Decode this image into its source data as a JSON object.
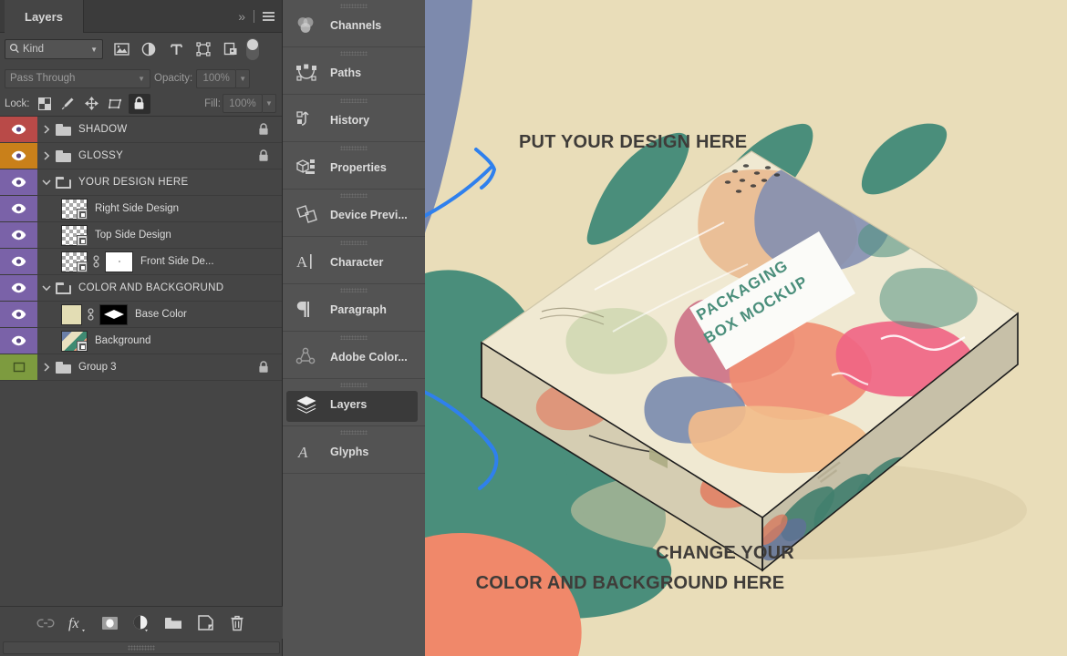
{
  "panel": {
    "tab_title": "Layers",
    "expand_icon": "chevrons-right-icon",
    "menu_icon": "panel-menu-icon",
    "filter": {
      "kind_label": "Kind",
      "search_icon": "search-icon",
      "caret_icon": "chevron-down-icon",
      "icons": [
        {
          "name": "filter-pixel-icon",
          "title": "Pixel layers"
        },
        {
          "name": "filter-adjustment-icon",
          "title": "Adjustment layers"
        },
        {
          "name": "filter-type-icon",
          "title": "Type layers"
        },
        {
          "name": "filter-shape-icon",
          "title": "Shape layers"
        },
        {
          "name": "filter-smartobject-icon",
          "title": "Smart objects"
        }
      ],
      "toggle_name": "filter-enable-toggle"
    },
    "blend": {
      "mode": "Pass Through",
      "opacity_label": "Opacity:",
      "opacity_value": "100%"
    },
    "lock": {
      "label": "Lock:",
      "fill_label": "Fill:",
      "fill_value": "100%",
      "buttons": [
        {
          "name": "lock-transparent-pixels-icon",
          "active": false
        },
        {
          "name": "lock-image-pixels-icon",
          "active": false
        },
        {
          "name": "lock-position-icon",
          "active": false
        },
        {
          "name": "lock-artboard-nesting-icon",
          "active": false
        },
        {
          "name": "lock-all-icon",
          "active": true
        }
      ]
    },
    "layers": [
      {
        "name": "SHADOW",
        "color": "#b94a48",
        "kind": "group",
        "expanded": false,
        "locked": true,
        "visible": true,
        "indent": 0,
        "caps": true
      },
      {
        "name": "GLOSSY",
        "color": "#c9801a",
        "kind": "group",
        "expanded": false,
        "locked": true,
        "visible": true,
        "indent": 0,
        "caps": true
      },
      {
        "name": "YOUR DESIGN HERE",
        "color": "#7a62a8",
        "kind": "group",
        "expanded": true,
        "locked": false,
        "visible": true,
        "indent": 0,
        "caps": true
      },
      {
        "name": "Right Side Design",
        "color": "#7a62a8",
        "kind": "smart",
        "expanded": null,
        "locked": false,
        "visible": true,
        "indent": 1,
        "caps": false
      },
      {
        "name": "Top Side Design",
        "color": "#7a62a8",
        "kind": "smart",
        "expanded": null,
        "locked": false,
        "visible": true,
        "indent": 1,
        "caps": false
      },
      {
        "name": "Front Side De...",
        "color": "#7a62a8",
        "kind": "smart-masked",
        "expanded": null,
        "locked": false,
        "visible": true,
        "indent": 1,
        "caps": false
      },
      {
        "name": "COLOR AND BACKGORUND",
        "color": "#7a62a8",
        "kind": "group",
        "expanded": true,
        "locked": false,
        "visible": true,
        "indent": 0,
        "caps": true
      },
      {
        "name": "Base Color",
        "color": "#7a62a8",
        "kind": "solid-masked",
        "expanded": null,
        "locked": false,
        "visible": true,
        "indent": 1,
        "caps": false,
        "swatch": "#e3ddb4"
      },
      {
        "name": "Background",
        "color": "#7a62a8",
        "kind": "image",
        "expanded": null,
        "locked": false,
        "visible": true,
        "indent": 1,
        "caps": false
      },
      {
        "name": "Group 3",
        "color": "#7d9b3f",
        "kind": "group",
        "expanded": false,
        "locked": true,
        "visible": false,
        "indent": 0,
        "caps": false
      }
    ],
    "bottom_buttons": [
      {
        "name": "link-layers-icon"
      },
      {
        "name": "layer-style-fx-icon"
      },
      {
        "name": "add-layer-mask-icon"
      },
      {
        "name": "new-adjustment-layer-icon"
      },
      {
        "name": "new-group-icon"
      },
      {
        "name": "new-layer-icon"
      },
      {
        "name": "delete-layer-icon"
      }
    ]
  },
  "dock": {
    "items": [
      {
        "label": "Channels",
        "icon": "channels-icon",
        "active": false
      },
      {
        "label": "Paths",
        "icon": "paths-icon",
        "active": false
      },
      {
        "label": "History",
        "icon": "history-icon",
        "active": false
      },
      {
        "label": "Properties",
        "icon": "properties-icon",
        "active": false
      },
      {
        "label": "Device Previ...",
        "icon": "device-preview-icon",
        "active": false
      },
      {
        "label": "Character",
        "icon": "character-icon",
        "active": false
      },
      {
        "label": "Paragraph",
        "icon": "paragraph-icon",
        "active": false
      },
      {
        "label": "Adobe Color...",
        "icon": "adobe-color-icon",
        "active": false
      },
      {
        "label": "Layers",
        "icon": "layers-icon",
        "active": true
      },
      {
        "label": "Glyphs",
        "icon": "glyphs-icon",
        "active": false
      }
    ]
  },
  "canvas": {
    "annotation_top": "PUT YOUR DESIGN HERE",
    "annotation_bottom_line1": "CHANGE YOUR",
    "annotation_bottom_line2": "COLOR AND BACKGROUND HERE",
    "box_label_line1": "PACKAGING",
    "box_label_line2": "BOX MOCKUP",
    "colors": {
      "background": "#e9ddb9",
      "teal": "#4a8e7b",
      "coral": "#f0886a",
      "blue_gray": "#7d8aad",
      "pink": "#f05d7e",
      "purple": "#7d6aa8",
      "arrow": "#2f80ed",
      "text": "#3f3c39",
      "box_face": "#ece3c8"
    }
  }
}
